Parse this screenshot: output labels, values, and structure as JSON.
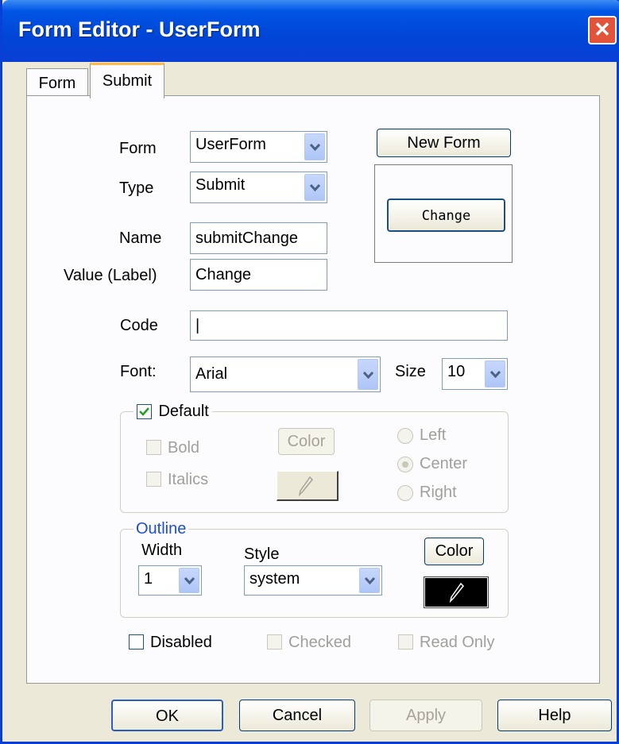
{
  "window": {
    "title": "Form Editor - UserForm",
    "close_label": "✕"
  },
  "tabs": [
    {
      "label": "Form"
    },
    {
      "label": "Submit"
    }
  ],
  "fields": {
    "form_label": "Form",
    "form_value": "UserForm",
    "type_label": "Type",
    "type_value": "Submit",
    "name_label": "Name",
    "name_value": "submitChange",
    "value_label": "Value (Label)",
    "value_value": "Change",
    "code_label": "Code",
    "code_value": "|",
    "font_label": "Font:",
    "font_value": "Arial",
    "size_label": "Size",
    "size_value": "10"
  },
  "preview": {
    "new_form_label": "New Form",
    "change_label": "Change"
  },
  "default_group": {
    "title": "Default",
    "checked": true,
    "bold_label": "Bold",
    "italics_label": "Italics",
    "color_label": "Color",
    "left_label": "Left",
    "center_label": "Center",
    "right_label": "Right"
  },
  "outline_group": {
    "title": "Outline",
    "width_label": "Width",
    "width_value": "1",
    "style_label": "Style",
    "style_value": "system",
    "color_label": "Color"
  },
  "options": {
    "disabled_label": "Disabled",
    "checked_label": "Checked",
    "readonly_label": "Read Only"
  },
  "buttons": {
    "ok": "OK",
    "cancel": "Cancel",
    "apply": "Apply",
    "help": "Help"
  },
  "colors": {
    "title_bar": "#0a3fd6",
    "outline_title": "#1c4fd6",
    "tab_highlight": "#ffb84a"
  }
}
